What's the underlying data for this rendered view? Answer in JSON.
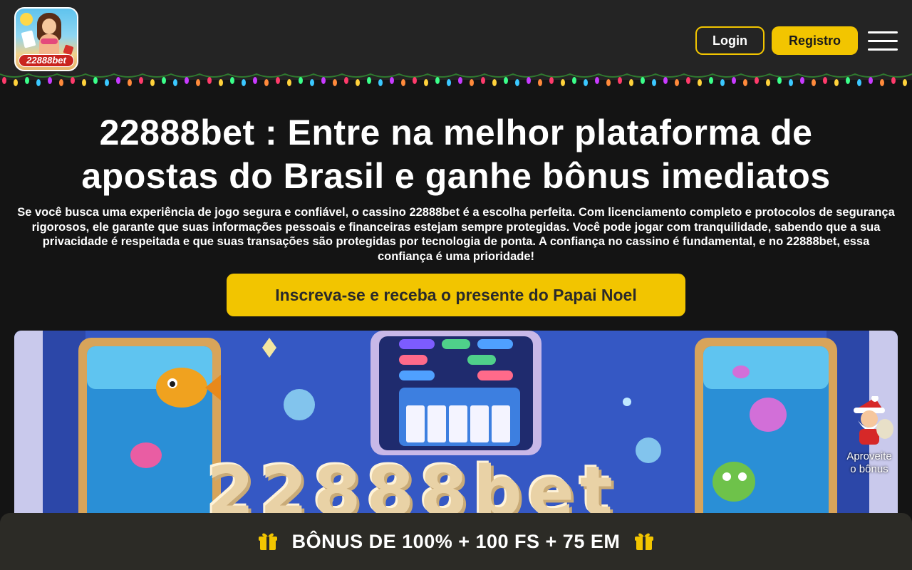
{
  "header": {
    "logo_text": "22888bet",
    "login_label": "Login",
    "register_label": "Registro"
  },
  "hero": {
    "title_line1": "22888bet : Entre na melhor plataforma de",
    "title_line2": "apostas do Brasil e ganhe bônus imediatos",
    "description": "Se você busca uma experiência de jogo segura e confiável, o cassino 22888bet é a escolha perfeita. Com licenciamento completo e protocolos de segurança rigorosos, ele garante que suas informações pessoais e financeiras estejam sempre protegidas. Você pode jogar com tranquilidade, sabendo que a sua privacidade é respeitada e que suas transações são protegidas por tecnologia de ponta. A confiança no cassino é fundamental, e no 22888bet, essa confiança é uma prioridade!",
    "cta_label": "Inscreva-se e receba o presente do Papai Noel"
  },
  "banner": {
    "text": "22888bet"
  },
  "floating_promo": {
    "label_line1": "Aproveite",
    "label_line2": "o bônus"
  },
  "bonus_bar": {
    "text": "BÔNUS DE 100% + 100 FS + 75 EM"
  },
  "colors": {
    "accent": "#f2c500",
    "header_bg": "#242424",
    "page_bg": "#141414",
    "bonus_bar_bg": "#2c2b26"
  },
  "icons": {
    "menu": "hamburger-menu-icon",
    "gift": "gift-icon",
    "santa": "santa-icon"
  }
}
